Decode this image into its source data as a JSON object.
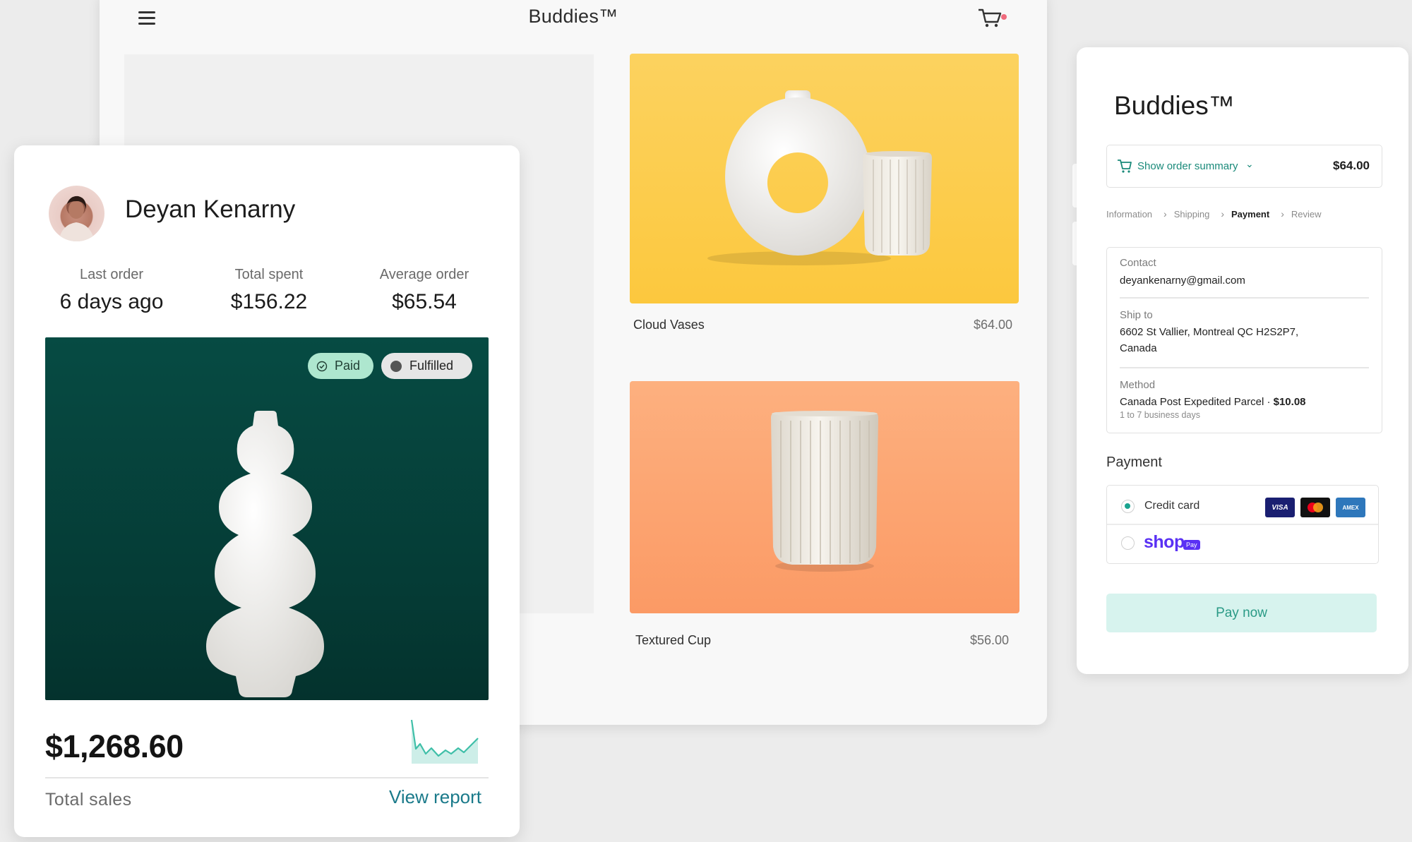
{
  "storefront": {
    "brand": "Buddies™",
    "products": [
      {
        "name": "Cloud Vases",
        "price": "$64.00"
      },
      {
        "name": "Textured Cup",
        "price": "$56.00"
      }
    ]
  },
  "customer": {
    "name": "Deyan Kenarny",
    "stats": [
      {
        "label": "Last order",
        "value": "6 days ago"
      },
      {
        "label": "Total spent",
        "value": "$156.22"
      },
      {
        "label": "Average order",
        "value": "$65.54"
      }
    ],
    "badges": {
      "paid": "Paid",
      "fulfilled": "Fulfilled"
    },
    "total_sales_amount": "$1,268.60",
    "total_sales_label": "Total sales",
    "view_report": "View report"
  },
  "checkout": {
    "brand": "Buddies™",
    "order_summary_label": "Show order summary",
    "order_summary_amount": "$64.00",
    "breadcrumbs": [
      "Information",
      "Shipping",
      "Payment",
      "Review"
    ],
    "active_step": "Payment",
    "contact_label": "Contact",
    "contact_value": "deyankenarny@gmail.com",
    "ship_label": "Ship to",
    "ship_value_line1": "6602 St Vallier, Montreal QC  H2S2P7,",
    "ship_value_line2": "Canada",
    "method_label": "Method",
    "method_name": "Canada Post Expedited Parcel · ",
    "method_price": "$10.08",
    "method_eta": "1 to 7 business days",
    "payment_heading": "Payment",
    "credit_card_label": "Credit card",
    "card_brands": [
      "VISA",
      "Mastercard",
      "AMEX"
    ],
    "shop_pay_label": "shop",
    "shop_pay_badge": "Pay",
    "pay_now": "Pay now"
  },
  "colors": {
    "accent_teal": "#1aa38f",
    "link_teal": "#1a7a8a",
    "cart_dot": "#ef6b7d",
    "shop_purple": "#5a31f4",
    "panel_green": "#064b43"
  }
}
